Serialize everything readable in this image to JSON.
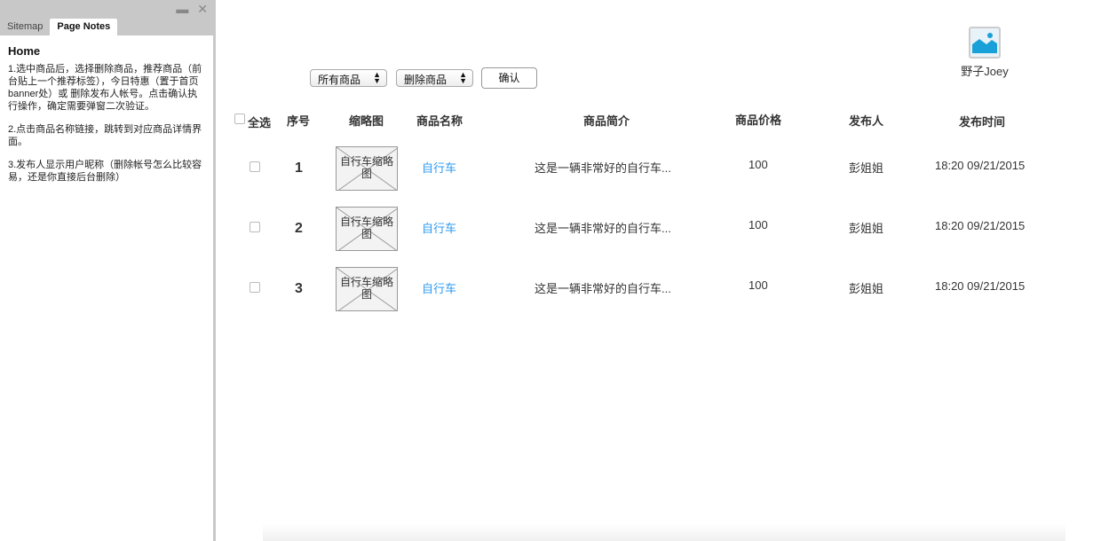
{
  "left_panel": {
    "tabs": [
      "Sitemap",
      "Page Notes"
    ],
    "window_controls": [
      "minimize-icon",
      "close-icon"
    ],
    "title": "Home",
    "notes": [
      "1.选中商品后，选择删除商品，推荐商品（前台贴上一个推荐标签），今日特惠（置于首页banner处）或 删除发布人帐号。点击确认执行操作，确定需要弹窗二次验证。",
      "2.点击商品名称链接，跳转到对应商品详情界面。",
      "3.发布人显示用户昵称（删除帐号怎么比较容易，还是你直接后台删除）"
    ]
  },
  "toolbar": {
    "filter_select": "所有商品",
    "action_select": "删除商品",
    "confirm_label": "确认"
  },
  "user": {
    "name": "野子Joey"
  },
  "table": {
    "headers": {
      "select_all": "全选",
      "index": "序号",
      "thumb": "缩略图",
      "name": "商品名称",
      "desc": "商品简介",
      "price": "商品价格",
      "publisher": "发布人",
      "time": "发布时间"
    },
    "rows": [
      {
        "index": "1",
        "thumb": "自行车缩略图",
        "name": "自行车",
        "desc": "这是一辆非常好的自行车...",
        "price": "100",
        "publisher": "彭姐姐",
        "time": "18:20 09/21/2015"
      },
      {
        "index": "2",
        "thumb": "自行车缩略图",
        "name": "自行车",
        "desc": "这是一辆非常好的自行车...",
        "price": "100",
        "publisher": "彭姐姐",
        "time": "18:20 09/21/2015"
      },
      {
        "index": "3",
        "thumb": "自行车缩略图",
        "name": "自行车",
        "desc": "这是一辆非常好的自行车...",
        "price": "100",
        "publisher": "彭姐姐",
        "time": "18:20 09/21/2015"
      }
    ]
  },
  "colors": {
    "link": "#2b9af3",
    "panel_gray": "#c8c8c8"
  }
}
